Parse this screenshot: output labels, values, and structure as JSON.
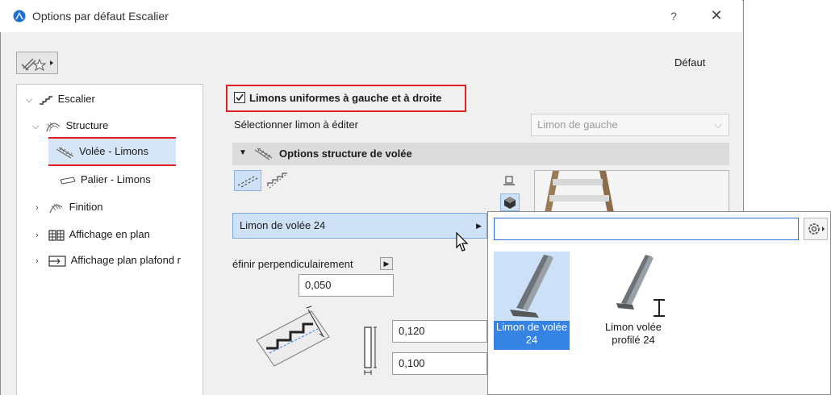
{
  "window": {
    "title": "Options par défaut Escalier",
    "help": "?",
    "close": "✕"
  },
  "header": {
    "default_label": "Défaut"
  },
  "tree": {
    "items": [
      {
        "label": "Escalier"
      },
      {
        "label": "Structure"
      },
      {
        "label": "Volée - Limons",
        "selected": true
      },
      {
        "label": "Palier - Limons"
      },
      {
        "label": "Finition"
      },
      {
        "label": "Affichage en plan"
      },
      {
        "label": "Affichage plan plafond r"
      }
    ]
  },
  "main": {
    "uniform_checkbox_label": "Limons uniformes à gauche et à droite",
    "uniform_checked": true,
    "select_stringer_label": "Sélectionner limon à éditer",
    "select_stringer_value": "Limon de gauche",
    "section_title": "Options structure de volée",
    "stringer_dropdown_value": "Limon de volée 24",
    "perpendicular_label": "éfinir perpendiculairement",
    "value_offset": "0,050",
    "value_width": "0,120",
    "value_depth": "0,100"
  },
  "popup": {
    "search_value": "",
    "tiles": [
      {
        "line1": "Limon de volée",
        "line2": "24",
        "selected": true
      },
      {
        "line1": "Limon volée",
        "line2": "profilé 24",
        "selected": false
      }
    ]
  },
  "colors": {
    "highlight_red": "#e0212a",
    "selection_blue": "#3584e4",
    "dropdown_bg": "#cfe1f7"
  }
}
